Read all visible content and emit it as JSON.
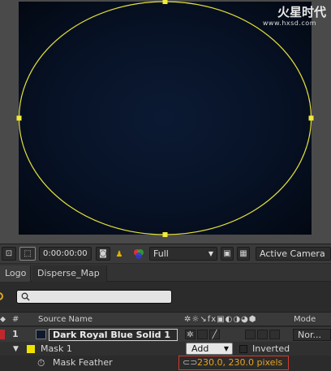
{
  "watermark": {
    "logo": "火星时代",
    "url": "www.hxsd.com"
  },
  "viewer_toolbar": {
    "timecode": "0:00:00:00",
    "resolution": "Full",
    "camera": "Active Camera"
  },
  "tabs": [
    {
      "label": "Logo"
    },
    {
      "label": "Disperse_Map"
    }
  ],
  "search": {
    "placeholder": ""
  },
  "columns": {
    "number": "#",
    "source_name": "Source Name",
    "mode": "Mode"
  },
  "layer": {
    "number": "1",
    "name": "Dark Royal Blue Solid 1",
    "label_color": "#0e1a2c",
    "mode": "Nor..."
  },
  "mask": {
    "name": "Mask 1",
    "label_color": "#f0e000",
    "mode": "Add",
    "inverted_label": "Inverted"
  },
  "mask_feather": {
    "name": "Mask Feather",
    "value": "230.0, 230.0 pixels"
  },
  "colors": {
    "mask_path": "#e3e03a",
    "highlight_border": "#d23a2a",
    "value_text": "#e6a320"
  }
}
